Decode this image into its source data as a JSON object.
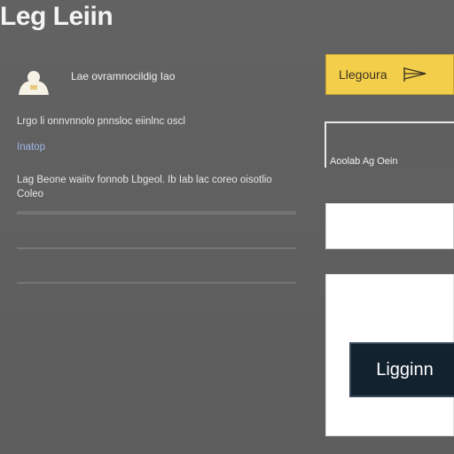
{
  "header": {
    "title": "Leg Leiin"
  },
  "profile": {
    "avatar_icon": "user-avatar-icon",
    "name": "Lae ovramnocildig Iao"
  },
  "content": {
    "description": "Lrgo li onnvnnolo pnnsloc eiinlnc oscl",
    "link_text": "Inatop",
    "note": "Lag Beone waiitv fonnob Lbgeol. Ib Iab lac coreo oisotlio Coleo"
  },
  "sidebar": {
    "language_button_label": "Llegoura",
    "language_icon": "flag-icon",
    "field_label": "Aoolab Ag Oein",
    "input_value": "",
    "input_placeholder": "",
    "login_button_label": "Ligginn"
  },
  "colors": {
    "background": "#5f5f5f",
    "accent_yellow": "#f3ce4a",
    "button_dark": "#13222f",
    "link_blue": "#9fb5e8"
  }
}
